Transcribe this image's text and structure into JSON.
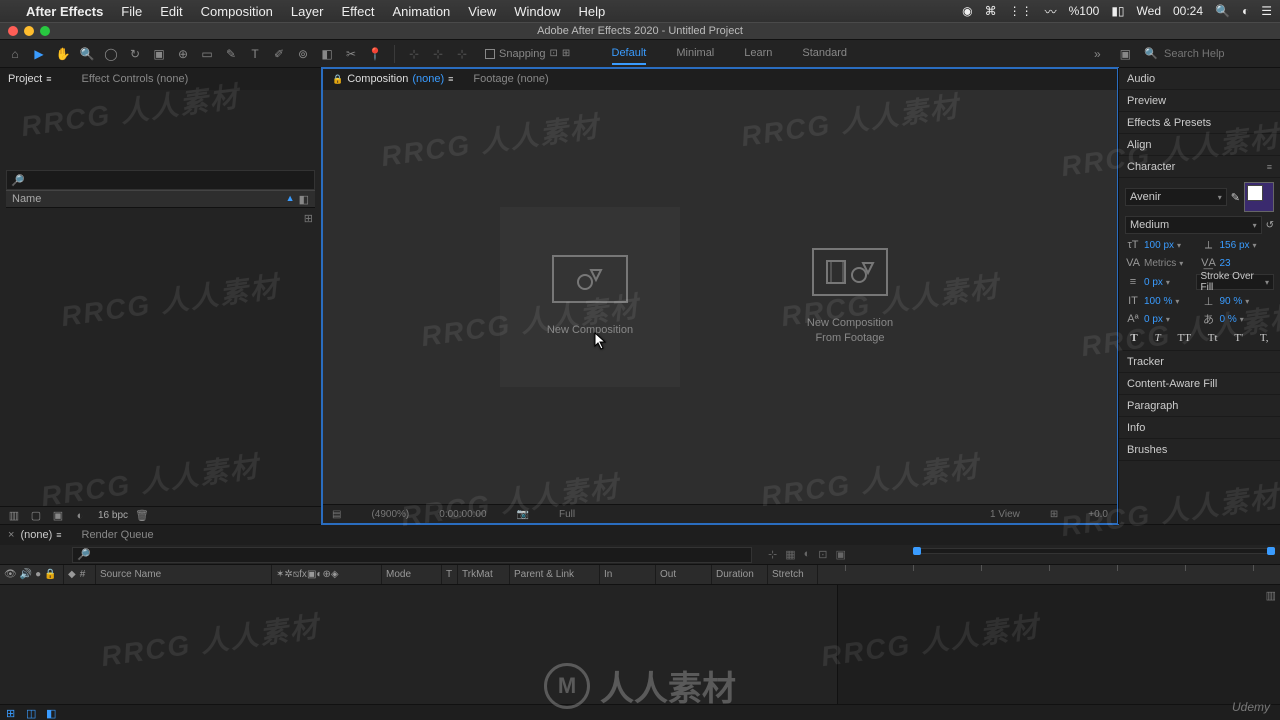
{
  "mac_menu": {
    "app": "After Effects",
    "items": [
      "File",
      "Edit",
      "Composition",
      "Layer",
      "Effect",
      "Animation",
      "View",
      "Window",
      "Help"
    ]
  },
  "mac_status": {
    "battery": "%100",
    "day": "Wed",
    "time": "00:24"
  },
  "window_title": "Adobe After Effects 2020 - Untitled Project",
  "toolbar": {
    "snapping": "Snapping"
  },
  "workspaces": {
    "items": [
      "Default",
      "Minimal",
      "Learn",
      "Standard"
    ],
    "active": "Default",
    "search_placeholder": "Search Help"
  },
  "left": {
    "tabs": {
      "project": "Project",
      "effect_controls": "Effect Controls (none)"
    },
    "col_name": "Name",
    "bpc": "16 bpc"
  },
  "center": {
    "tabs": {
      "composition_label": "Composition",
      "composition_value": "(none)",
      "footage": "Footage (none)"
    },
    "new_comp": "New Composition",
    "new_comp_footage": "New Composition\nFrom Footage",
    "footer": {
      "zoom": "(4900%)",
      "time": "0:00:00:00",
      "resolution": "Full",
      "views": "1 View",
      "exposure": "+0.0"
    }
  },
  "right": {
    "panels": [
      "Audio",
      "Preview",
      "Effects & Presets",
      "Align"
    ],
    "character": {
      "title": "Character",
      "font": "Avenir",
      "style": "Medium",
      "size": "100 px",
      "leading": "156 px",
      "kerning": "Metrics",
      "tracking": "23",
      "stroke_w": "0 px",
      "stroke_mode": "Stroke Over Fill",
      "vscale": "100 %",
      "hscale": "90 %",
      "baseline": "0 px",
      "tsume": "0 %",
      "type_btns": [
        "T",
        "T",
        "TT",
        "Tt",
        "T'",
        "T,"
      ]
    },
    "panels2": [
      "Tracker",
      "Content-Aware Fill",
      "Paragraph",
      "Info",
      "Brushes"
    ]
  },
  "timeline": {
    "tab_none": "(none)",
    "render_queue": "Render Queue",
    "cols": {
      "source": "Source Name",
      "mode": "Mode",
      "t": "T",
      "trkmat": "TrkMat",
      "parent": "Parent & Link",
      "in": "In",
      "out": "Out",
      "duration": "Duration",
      "stretch": "Stretch"
    }
  },
  "watermark": {
    "text": "RRCG 人人素材",
    "big": "人人素材",
    "brand": "Udemy"
  }
}
